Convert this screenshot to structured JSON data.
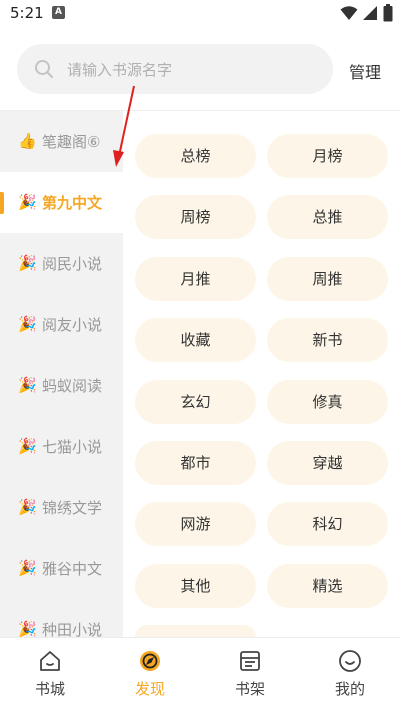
{
  "status": {
    "time": "5:21",
    "notice_letter": "A"
  },
  "search": {
    "placeholder": "请输入书源名字",
    "manage_label": "管理"
  },
  "sidebar": {
    "items": [
      {
        "icon": "👍",
        "label": "笔趣阁⑥",
        "active": false
      },
      {
        "icon": "🎉",
        "label": "第九中文",
        "active": true
      },
      {
        "icon": "🎉",
        "label": "阅民小说",
        "active": false
      },
      {
        "icon": "🎉",
        "label": "阅友小说",
        "active": false
      },
      {
        "icon": "🎉",
        "label": "蚂蚁阅读",
        "active": false
      },
      {
        "icon": "🎉",
        "label": "七猫小说",
        "active": false
      },
      {
        "icon": "🎉",
        "label": "锦绣文学",
        "active": false
      },
      {
        "icon": "🎉",
        "label": "雅谷中文",
        "active": false
      },
      {
        "icon": "🎉",
        "label": "种田小说",
        "active": false
      }
    ]
  },
  "categories": [
    "总榜",
    "月榜",
    "周榜",
    "总推",
    "月推",
    "周推",
    "收藏",
    "新书",
    "玄幻",
    "修真",
    "都市",
    "穿越",
    "网游",
    "科幻",
    "其他",
    "精选"
  ],
  "bottom_nav": [
    {
      "label": "书城",
      "icon": "home-icon",
      "active": false
    },
    {
      "label": "发现",
      "icon": "discover-icon",
      "active": true
    },
    {
      "label": "书架",
      "icon": "bookshelf-icon",
      "active": false
    },
    {
      "label": "我的",
      "icon": "profile-icon",
      "active": false
    }
  ],
  "colors": {
    "accent": "#f5a623",
    "tag_bg": "#fdf6e8",
    "sidebar_bg": "#f2f2f2",
    "annotation_arrow": "#e02020"
  }
}
